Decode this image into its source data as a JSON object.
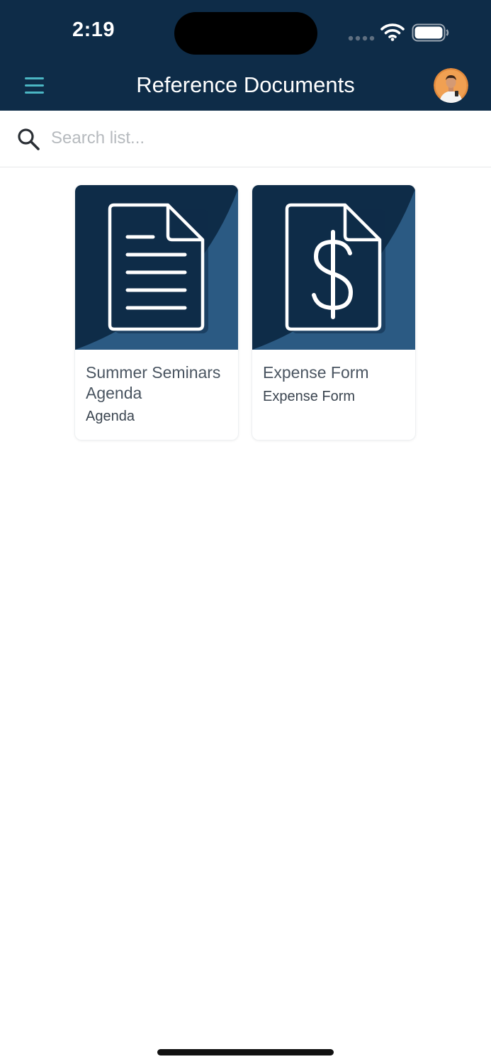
{
  "status_bar": {
    "time": "2:19"
  },
  "header": {
    "title": "Reference Documents",
    "menu_icon": "hamburger-menu-icon",
    "avatar_icon": "user-avatar"
  },
  "search": {
    "placeholder": "Search list...",
    "value": "",
    "icon": "search-icon"
  },
  "documents": [
    {
      "title": "Summer Seminars Agenda",
      "subtitle": "Agenda",
      "icon": "document-lines-icon"
    },
    {
      "title": "Expense Form",
      "subtitle": "Expense Form",
      "icon": "document-dollar-icon"
    }
  ],
  "colors": {
    "header_bg": "#0e2c48",
    "thumb_dark": "#0e2c48",
    "thumb_light": "#2b5a83",
    "accent_teal": "#4bb6c3",
    "card_text": "#4a5561"
  }
}
